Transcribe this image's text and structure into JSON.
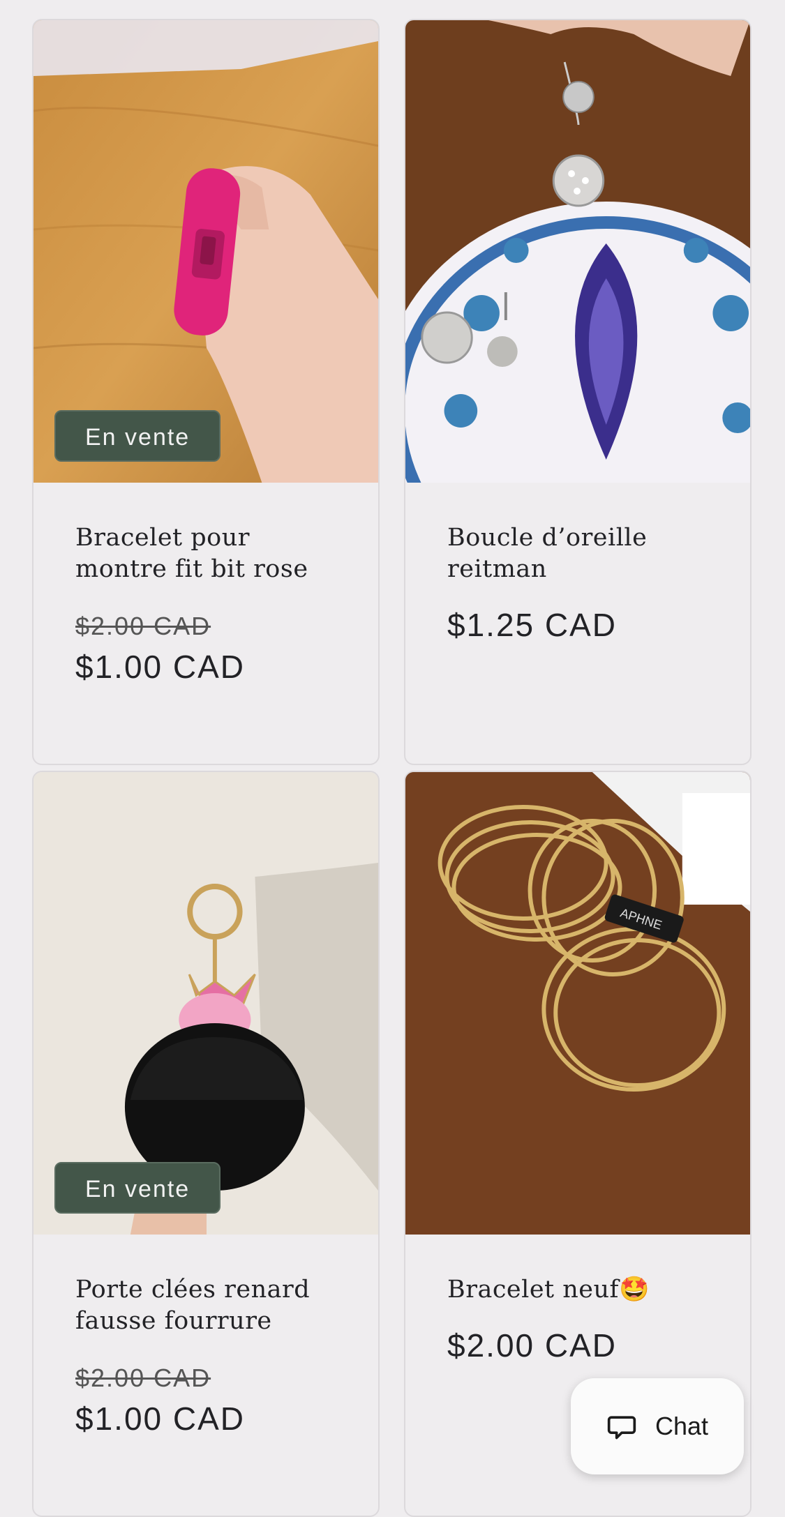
{
  "products": [
    {
      "title_line1": "Bracelet pour",
      "title_line2": "montre fit bit rose",
      "original_price": "$2.00 CAD",
      "price": "$1.00 CAD",
      "badge": "En vente",
      "image_desc_icon": "pink-watch-band-photo"
    },
    {
      "title_line1": "Boucle d’oreille",
      "title_line2": "reitman",
      "price": "$1.25 CAD",
      "image_desc_icon": "rhinestone-earrings-photo"
    },
    {
      "title_line1": "Porte clées renard",
      "title_line2": "fausse fourrure",
      "original_price": "$2.00 CAD",
      "price": "$1.00 CAD",
      "badge": "En vente",
      "image_desc_icon": "fox-fur-keychain-photo"
    },
    {
      "title_line1": "Bracelet neuf🤩",
      "price": "$2.00 CAD",
      "image_desc_icon": "gold-bangles-photo"
    }
  ],
  "chat": {
    "label": "Chat",
    "icon": "chat-bubble-icon"
  },
  "colors": {
    "badge_bg": "#435649",
    "page_bg": "#efedef",
    "text": "#222226"
  }
}
